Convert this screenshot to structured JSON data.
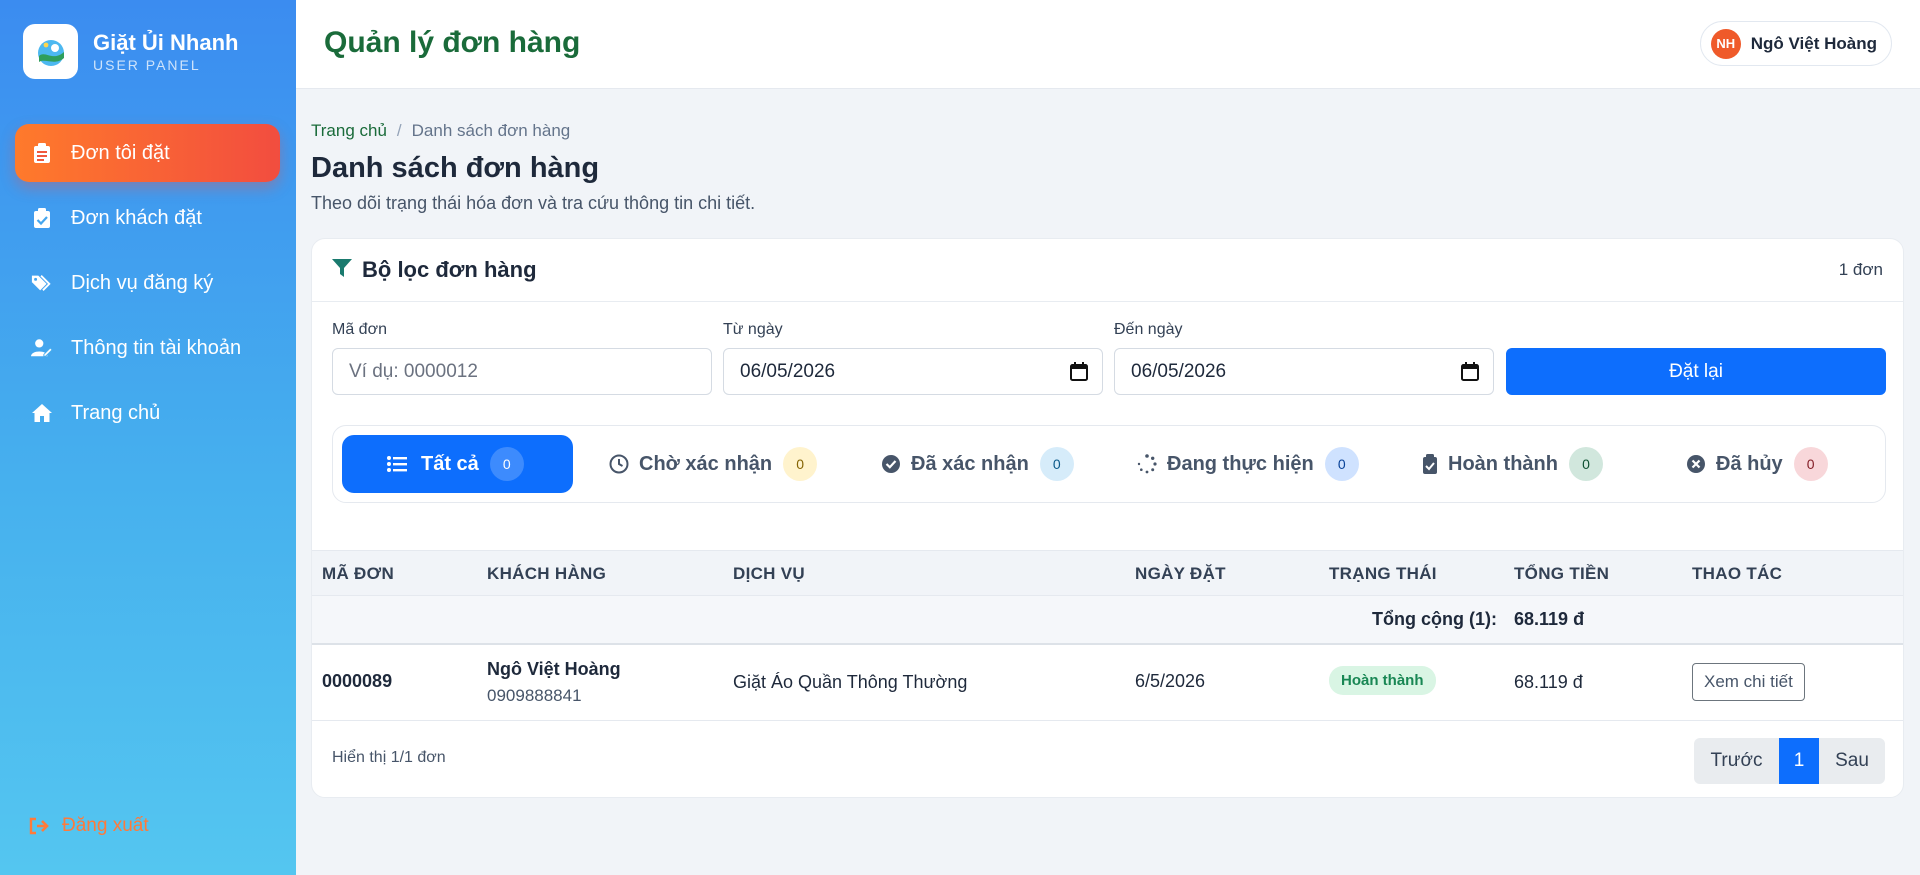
{
  "brand": {
    "name": "Giặt Ủi Nhanh",
    "subtitle": "USER PANEL"
  },
  "sidebar": {
    "items": [
      {
        "label": "Đơn tôi đặt",
        "icon": "clipboard-list-icon",
        "active": true
      },
      {
        "label": "Đơn khách đặt",
        "icon": "clipboard-check-icon",
        "active": false
      },
      {
        "label": "Dịch vụ đăng ký",
        "icon": "tags-icon",
        "active": false
      },
      {
        "label": "Thông tin tài khoản",
        "icon": "user-edit-icon",
        "active": false
      },
      {
        "label": "Trang chủ",
        "icon": "home-icon",
        "active": false
      }
    ],
    "logout_label": "Đăng xuất"
  },
  "header": {
    "title": "Quản lý đơn hàng",
    "user": {
      "initials": "NH",
      "name": "Ngô Việt Hoàng"
    }
  },
  "breadcrumb": {
    "home": "Trang chủ",
    "separator": "/",
    "current": "Danh sách đơn hàng"
  },
  "page": {
    "title": "Danh sách đơn hàng",
    "description": "Theo dõi trạng thái hóa đơn và tra cứu thông tin chi tiết."
  },
  "filter_card": {
    "title": "Bộ lọc đơn hàng",
    "count": "1 đơn",
    "order_code": {
      "label": "Mã đơn",
      "placeholder": "Ví dụ: 0000012"
    },
    "from_date": {
      "label": "Từ ngày",
      "value": "06/05/2026"
    },
    "to_date": {
      "label": "Đến ngày",
      "value": "06/05/2026"
    },
    "reset_label": "Đặt lại"
  },
  "status_tabs": [
    {
      "label": "Tất cả",
      "count": "0",
      "icon": "list-icon",
      "active": true
    },
    {
      "label": "Chờ xác nhận",
      "count": "0",
      "icon": "clock-icon",
      "badge_bg": "#fff3cd",
      "badge_fg": "#856404"
    },
    {
      "label": "Đã xác nhận",
      "count": "0",
      "icon": "check-circle-icon",
      "badge_bg": "#d6ecfa",
      "badge_fg": "#0b5a8a"
    },
    {
      "label": "Đang thực hiện",
      "count": "0",
      "icon": "spinner-icon",
      "badge_bg": "#cfe2ff",
      "badge_fg": "#084298"
    },
    {
      "label": "Hoàn thành",
      "count": "0",
      "icon": "clipboard-check-icon",
      "badge_bg": "#d1e7dd",
      "badge_fg": "#0f5132"
    },
    {
      "label": "Đã hủy",
      "count": "0",
      "icon": "times-circle-icon",
      "badge_bg": "#f8d7da",
      "badge_fg": "#842029"
    }
  ],
  "table": {
    "columns": [
      "MÃ ĐƠN",
      "KHÁCH HÀNG",
      "DỊCH VỤ",
      "NGÀY ĐẶT",
      "TRẠNG THÁI",
      "TỔNG TIỀN",
      "THAO TÁC"
    ],
    "total_label": "Tổng cộng (1):",
    "total_value": "68.119 đ",
    "rows": [
      {
        "code": "0000089",
        "customer_name": "Ngô Việt Hoàng",
        "customer_phone": "0909888841",
        "service": "Giặt Áo Quần Thông Thường",
        "date": "6/5/2026",
        "status": "Hoàn thành",
        "total": "68.119 đ",
        "action": "Xem chi tiết"
      }
    ],
    "footer_info": "Hiển thị 1/1 đơn"
  },
  "pagination": {
    "prev": "Trước",
    "current": "1",
    "next": "Sau"
  },
  "colors": {
    "sidebar_gradient_top": "#3b8cf0",
    "sidebar_gradient_bottom": "#54c6f0",
    "active_nav": "#f24d3f",
    "primary": "#0d6efd",
    "header_title": "#1a6b3a",
    "success_bg": "#d9f5e4",
    "success_fg": "#198754"
  }
}
